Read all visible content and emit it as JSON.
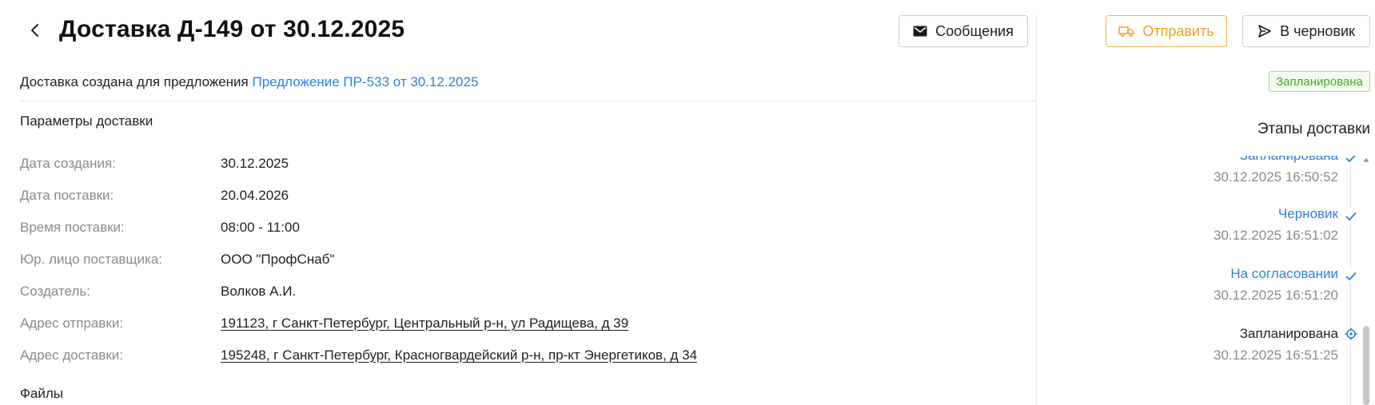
{
  "header": {
    "title": "Доставка Д-149 от 30.12.2025",
    "messages_label": "Сообщения",
    "send_label": "Отправить",
    "draft_label": "В черновик"
  },
  "created_info": {
    "prefix": "Доставка создана для предложения",
    "link": "Предложение ПР-533 от 30.12.2025"
  },
  "params": {
    "title": "Параметры доставки",
    "rows": [
      {
        "label": "Дата создания:",
        "value": "30.12.2025"
      },
      {
        "label": "Дата поставки:",
        "value": "20.04.2026"
      },
      {
        "label": "Время поставки:",
        "value": "08:00 - 11:00"
      },
      {
        "label": "Юр. лицо поставщика:",
        "value": "ООО \"ПрофСнаб\""
      },
      {
        "label": "Создатель:",
        "value": "Волков А.И."
      },
      {
        "label": "Адрес отправки:",
        "value": "191123, г Санкт-Петербург, Центральный р-н, ул Радищева, д 39"
      },
      {
        "label": "Адрес доставки:",
        "value": "195248, г Санкт-Петербург, Красногвардейский р-н, пр-кт Энергетиков, д 34"
      }
    ]
  },
  "files": {
    "title": "Файлы"
  },
  "status": {
    "badge": "Запланирована"
  },
  "stages": {
    "title": "Этапы доставки",
    "items": [
      {
        "name": "Запланирована",
        "time": "30.12.2025 16:50:52",
        "state": "done"
      },
      {
        "name": "Черновик",
        "time": "30.12.2025 16:51:02",
        "state": "done"
      },
      {
        "name": "На согласовании",
        "time": "30.12.2025 16:51:20",
        "state": "done"
      },
      {
        "name": "Запланирована",
        "time": "30.12.2025 16:51:25",
        "state": "current"
      }
    ]
  },
  "colors": {
    "link": "#2f7fe0",
    "accent_orange": "#f0a020",
    "status_green": "#48a928"
  },
  "icons": {
    "back": "chevron-left-icon",
    "messages": "envelope-icon",
    "send": "truck-icon",
    "draft": "paper-plane-icon",
    "stage_done": "check-icon",
    "stage_current": "target-icon"
  }
}
